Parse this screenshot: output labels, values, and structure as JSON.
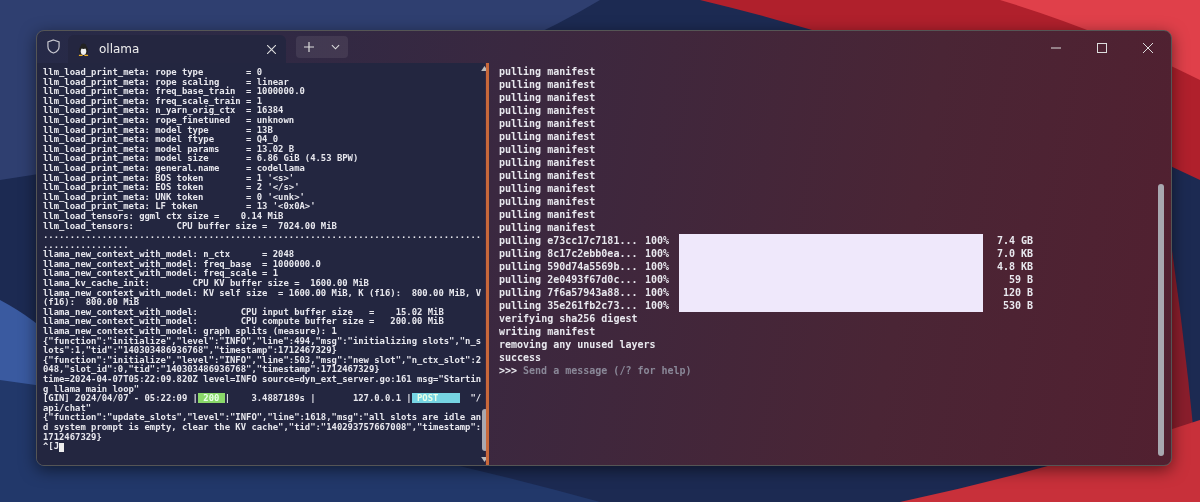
{
  "window": {
    "tabs": [
      {
        "title": "ollama",
        "selected": true
      }
    ]
  },
  "left_pane": {
    "lines": [
      {
        "kind": "text",
        "text": "llm_load_print_meta: rope type        = 0"
      },
      {
        "kind": "text",
        "text": "llm_load_print_meta: rope scaling     = linear"
      },
      {
        "kind": "text",
        "text": "llm_load_print_meta: freq_base_train  = 1000000.0"
      },
      {
        "kind": "text",
        "text": "llm_load_print_meta: freq_scale_train = 1"
      },
      {
        "kind": "text",
        "text": "llm_load_print_meta: n_yarn_orig_ctx  = 16384"
      },
      {
        "kind": "text",
        "text": "llm_load_print_meta: rope_finetuned   = unknown"
      },
      {
        "kind": "text",
        "text": "llm_load_print_meta: model type       = 13B"
      },
      {
        "kind": "text",
        "text": "llm_load_print_meta: model ftype      = Q4_0"
      },
      {
        "kind": "text",
        "text": "llm_load_print_meta: model params     = 13.02 B"
      },
      {
        "kind": "text",
        "text": "llm_load_print_meta: model size       = 6.86 GiB (4.53 BPW)"
      },
      {
        "kind": "text",
        "text": "llm_load_print_meta: general.name     = codellama"
      },
      {
        "kind": "text",
        "text": "llm_load_print_meta: BOS token        = 1 '<s>'"
      },
      {
        "kind": "text",
        "text": "llm_load_print_meta: EOS token        = 2 '</s>'"
      },
      {
        "kind": "text",
        "text": "llm_load_print_meta: UNK token        = 0 '<unk>'"
      },
      {
        "kind": "text",
        "text": "llm_load_print_meta: LF token         = 13 '<0x0A>'"
      },
      {
        "kind": "text",
        "text": "llm_load_tensors: ggml ctx size =    0.14 MiB"
      },
      {
        "kind": "text",
        "text": "llm_load_tensors:        CPU buffer size =  7024.00 MiB"
      },
      {
        "kind": "text",
        "text": ".................................................................................................."
      },
      {
        "kind": "text",
        "text": "llama_new_context_with_model: n_ctx      = 2048"
      },
      {
        "kind": "text",
        "text": "llama_new_context_with_model: freq_base  = 1000000.0"
      },
      {
        "kind": "text",
        "text": "llama_new_context_with_model: freq_scale = 1"
      },
      {
        "kind": "text",
        "text": "llama_kv_cache_init:        CPU KV buffer size =  1600.00 MiB"
      },
      {
        "kind": "text",
        "text": "llama_new_context_with_model: KV self size  = 1600.00 MiB, K (f16):  800.00 MiB, V (f16):  800.00 MiB"
      },
      {
        "kind": "text",
        "text": "llama_new_context_with_model:        CPU input buffer size   =    15.02 MiB"
      },
      {
        "kind": "text",
        "text": "llama_new_context_with_model:        CPU compute buffer size =   200.00 MiB"
      },
      {
        "kind": "text",
        "text": "llama_new_context_with_model: graph splits (measure): 1"
      },
      {
        "kind": "text",
        "text": "{\"function\":\"initialize\",\"level\":\"INFO\",\"line\":494,\"msg\":\"initializing slots\",\"n_slots\":1,\"tid\":\"140303486936768\",\"timestamp\":1712467329}"
      },
      {
        "kind": "text",
        "text": "{\"function\":\"initialize\",\"level\":\"INFO\",\"line\":503,\"msg\":\"new slot\",\"n_ctx_slot\":2048,\"slot_id\":0,\"tid\":\"140303486936768\",\"timestamp\":1712467329}"
      },
      {
        "kind": "text",
        "text": "time=2024-04-07T05:22:09.820Z level=INFO source=dyn_ext_server.go:161 msg=\"Starting llama main loop\""
      },
      {
        "kind": "gin",
        "prefix": "[GIN] 2024/04/07 - 05:22:09 |",
        "status": " 200 ",
        "middle": "|    3.4887189s |       127.0.0.1 |",
        "method": " POST    ",
        "suffix": "  \"/api/chat\""
      },
      {
        "kind": "text",
        "text": "{\"function\":\"update_slots\",\"level\":\"INFO\",\"line\":1618,\"msg\":\"all slots are idle and system prompt is empty, clear the KV cache\",\"tid\":\"140293757667008\",\"timestamp\":1712467329}"
      },
      {
        "kind": "cursor",
        "text": "^[J"
      }
    ]
  },
  "right_pane": {
    "lines": [
      {
        "kind": "text",
        "text": "pulling manifest"
      },
      {
        "kind": "text",
        "text": "pulling manifest"
      },
      {
        "kind": "text",
        "text": "pulling manifest"
      },
      {
        "kind": "text",
        "text": "pulling manifest"
      },
      {
        "kind": "text",
        "text": "pulling manifest"
      },
      {
        "kind": "text",
        "text": "pulling manifest"
      },
      {
        "kind": "text",
        "text": "pulling manifest"
      },
      {
        "kind": "text",
        "text": "pulling manifest"
      },
      {
        "kind": "text",
        "text": "pulling manifest"
      },
      {
        "kind": "text",
        "text": "pulling manifest"
      },
      {
        "kind": "text",
        "text": "pulling manifest"
      },
      {
        "kind": "text",
        "text": "pulling manifest"
      },
      {
        "kind": "text",
        "text": "pulling manifest"
      },
      {
        "kind": "progress",
        "name": "pulling e73cc17c7181...",
        "percent": "100%",
        "level": 1,
        "size": "7.4 GB"
      },
      {
        "kind": "progress",
        "name": "pulling 8c17c2ebb0ea...",
        "percent": "100%",
        "level": 1,
        "size": "7.0 KB"
      },
      {
        "kind": "progress",
        "name": "pulling 590d74a5569b...",
        "percent": "100%",
        "level": 1,
        "size": "4.8 KB"
      },
      {
        "kind": "progress",
        "name": "pulling 2e0493f67d0c...",
        "percent": "100%",
        "level": 1,
        "size": "59 B"
      },
      {
        "kind": "progress",
        "name": "pulling 7f6a57943a88...",
        "percent": "100%",
        "level": 1,
        "size": "120 B"
      },
      {
        "kind": "progress",
        "name": "pulling 35e261fb2c73...",
        "percent": "100%",
        "level": 1,
        "size": "530 B"
      },
      {
        "kind": "text",
        "text": "verifying sha256 digest"
      },
      {
        "kind": "text",
        "text": "writing manifest"
      },
      {
        "kind": "text",
        "text": "removing any unused layers"
      },
      {
        "kind": "text",
        "text": "success"
      }
    ],
    "prompt": {
      "symbol": ">>>",
      "placeholder": "Send a message (/? for help)"
    }
  }
}
